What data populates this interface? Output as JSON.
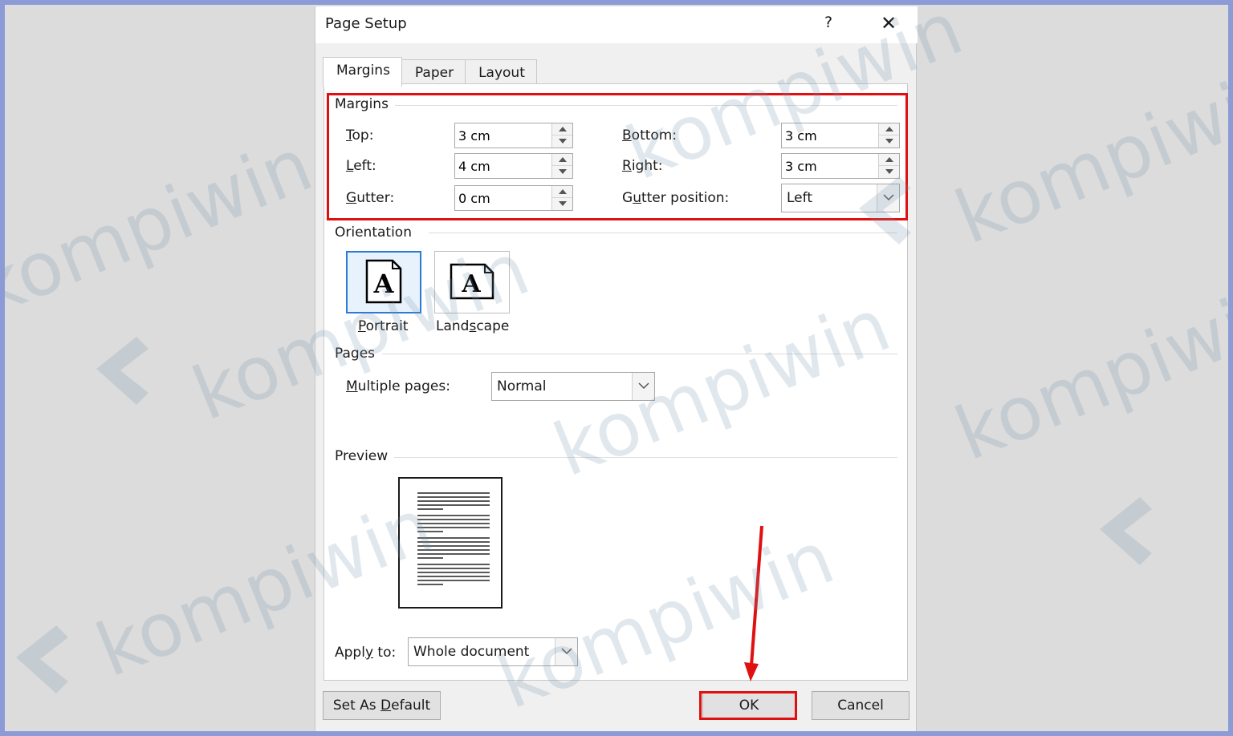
{
  "dialog": {
    "title": "Page Setup",
    "help": "?",
    "close": "✕"
  },
  "tabs": [
    {
      "label": "Margins",
      "active": true
    },
    {
      "label": "Paper",
      "active": false
    },
    {
      "label": "Layout",
      "active": false
    }
  ],
  "margins": {
    "section_label": "Margins",
    "top": {
      "label_u": "T",
      "label_rest": "op:",
      "value": "3 cm"
    },
    "left": {
      "label_u": "L",
      "label_rest": "eft:",
      "value": "4 cm"
    },
    "gutter": {
      "label_u": "G",
      "label_rest": "utter:",
      "value": "0 cm"
    },
    "bottom": {
      "label_u": "B",
      "label_rest": "ottom:",
      "value": "3 cm"
    },
    "right": {
      "label_u": "R",
      "label_rest": "ight:",
      "value": "3 cm"
    },
    "gutter_position": {
      "label_pre": "G",
      "label_u": "u",
      "label_rest": "tter position:",
      "value": "Left"
    }
  },
  "orientation": {
    "section_label": "Orientation",
    "portrait": {
      "label_u": "P",
      "label_rest": "ortrait",
      "selected": true
    },
    "landscape": {
      "label_pre": "Land",
      "label_u": "s",
      "label_rest": "cape",
      "selected": false
    }
  },
  "pages": {
    "section_label": "Pages",
    "multiple_pages": {
      "label_u": "M",
      "label_rest": "ultiple pages:",
      "value": "Normal"
    }
  },
  "preview": {
    "section_label": "Preview"
  },
  "apply_to": {
    "label_pre": "Appl",
    "label_u": "y",
    "label_rest": " to:",
    "value": "Whole document"
  },
  "buttons": {
    "set_default_pre": "Set As ",
    "set_default_u": "D",
    "set_default_rest": "efault",
    "ok": "OK",
    "cancel": "Cancel"
  },
  "watermark": "kompiwin",
  "colors": {
    "highlight": "#e01010",
    "selected_border": "#2a7bd3",
    "frame": "#8c9bd6"
  }
}
